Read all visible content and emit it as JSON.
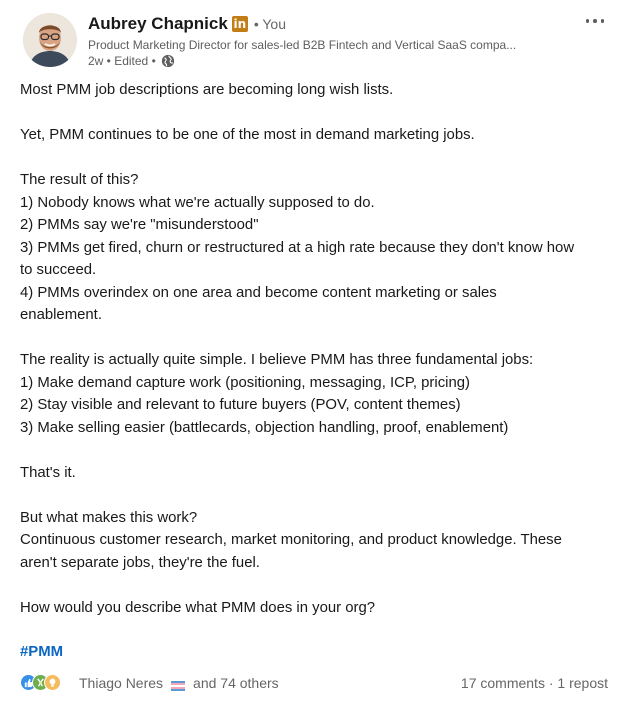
{
  "author": {
    "name": "Aubrey Chapnick",
    "badge": "in",
    "relation": "• You",
    "headline": "Product Marketing Director for sales-led B2B Fintech and Vertical SaaS compa...",
    "time": "2w • Edited •"
  },
  "post": {
    "lines": [
      "Most PMM job descriptions are becoming long wish lists.",
      "",
      "Yet, PMM continues to be one of the most in demand marketing jobs.",
      "",
      "The result of this?",
      "1) Nobody knows what we're actually supposed to do.",
      "2) PMMs say we're \"misunderstood\"",
      "3) PMMs get fired, churn or restructured at a high rate because they don't know how",
      "to succeed.",
      "4) PMMs overindex on one area and become content marketing or sales",
      "enablement.",
      "",
      "The reality is actually quite simple. I believe PMM has three fundamental jobs:",
      "1) Make demand capture work (positioning, messaging, ICP, pricing)",
      "2) Stay visible and relevant to future buyers (POV, content themes)",
      "3) Make selling easier (battlecards, objection handling, proof, enablement)",
      "",
      "That's it.",
      "",
      "But what makes this work?",
      "Continuous customer research, market monitoring, and product knowledge. These",
      "aren't separate jobs, they're the fuel.",
      "",
      "How would you describe what PMM does in your org?"
    ],
    "hashtag": "#PMM"
  },
  "social": {
    "reactor": "Thiago Neres",
    "others": "and 74 others",
    "comments": "17 comments",
    "separator": " · ",
    "reposts": "1 repost",
    "reaction_icons": [
      "like-icon",
      "celebrate-icon",
      "insightful-icon"
    ]
  },
  "colors": {
    "link": "#0a66c2",
    "secondary_text": "#666666",
    "linkedin_badge": "#c37d16"
  }
}
